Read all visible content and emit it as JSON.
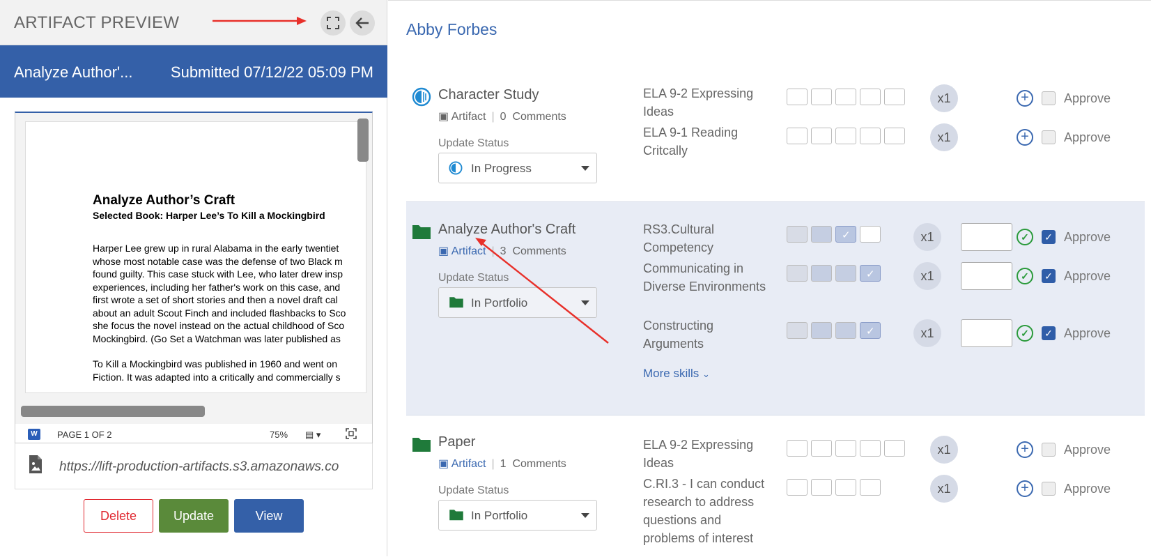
{
  "left_panel": {
    "header_title": "ARTIFACT PREVIEW",
    "artifact_title": "Analyze Author'...",
    "submitted": "Submitted 07/12/22 05:09 PM",
    "doc": {
      "heading": "Analyze Author’s Craft",
      "subheading": "Selected Book: Harper Lee’s To Kill a Mockingbird",
      "lines": [
        "Harper Lee grew up in rural Alabama in the early twentiet",
        "whose most notable case was the defense of two Black m",
        "found guilty. This case stuck with Lee, who later drew insp",
        "experiences, including her father's work on this case, and",
        "first wrote a set of short stories and then a novel draft cal",
        "about an adult Scout Finch and included flashbacks to Sco",
        "she focus the novel instead on the actual childhood of Sco",
        "Mockingbird. (Go Set a Watchman was later published as"
      ],
      "lines2": [
        "To Kill a Mockingbird was published in 1960 and went on",
        "Fiction. It was adapted into a critically and commercially s"
      ],
      "page_info": "PAGE 1 OF 2",
      "zoom": "75%"
    },
    "url": "https://lift-production-artifacts.s3.amazonaws.co",
    "buttons": {
      "delete": "Delete",
      "update": "Update",
      "view": "View"
    }
  },
  "right_panel": {
    "student_name": "Abby Forbes",
    "approve_label": "Approve",
    "multiplier": "x1",
    "sections": [
      {
        "title": "Character Study",
        "artifact_link": "Artifact",
        "comments_count": "0",
        "comments_label": "Comments",
        "status_label": "Update Status",
        "status_value": "In Progress",
        "skills": [
          {
            "name": "ELA 9-2 Expressing Ideas",
            "levels": 5,
            "filled": 0,
            "approved": false
          },
          {
            "name": "ELA 9-1 Reading Critcally",
            "levels": 5,
            "filled": 0,
            "approved": false
          }
        ]
      },
      {
        "title": "Analyze Author's Craft",
        "artifact_link": "Artifact",
        "comments_count": "3",
        "comments_label": "Comments",
        "status_label": "Update Status",
        "status_value": "In Portfolio",
        "skills": [
          {
            "name": "RS3.Cultural Competency",
            "levels": 4,
            "filled": 3,
            "approved": true
          },
          {
            "name": "Communicating in Diverse Environments",
            "levels": 4,
            "filled": 4,
            "approved": true
          },
          {
            "name": "Constructing Arguments",
            "levels": 4,
            "filled": 4,
            "approved": true
          }
        ],
        "more_skills": "More skills"
      },
      {
        "title": "Paper",
        "artifact_link": "Artifact",
        "comments_count": "1",
        "comments_label": "Comments",
        "status_label": "Update Status",
        "status_value": "In Portfolio",
        "skills": [
          {
            "name": "ELA 9-2 Expressing Ideas",
            "levels": 5,
            "filled": 0,
            "approved": false
          },
          {
            "name": "C.RI.3 - I can conduct research to address questions and problems of interest",
            "levels": 4,
            "filled": 0,
            "approved": false
          }
        ]
      }
    ]
  },
  "colors": {
    "brand_blue": "#3460a8",
    "approve_green": "#2a9a3a",
    "delete_red": "#e0272f",
    "update_green": "#5a8a3a"
  }
}
